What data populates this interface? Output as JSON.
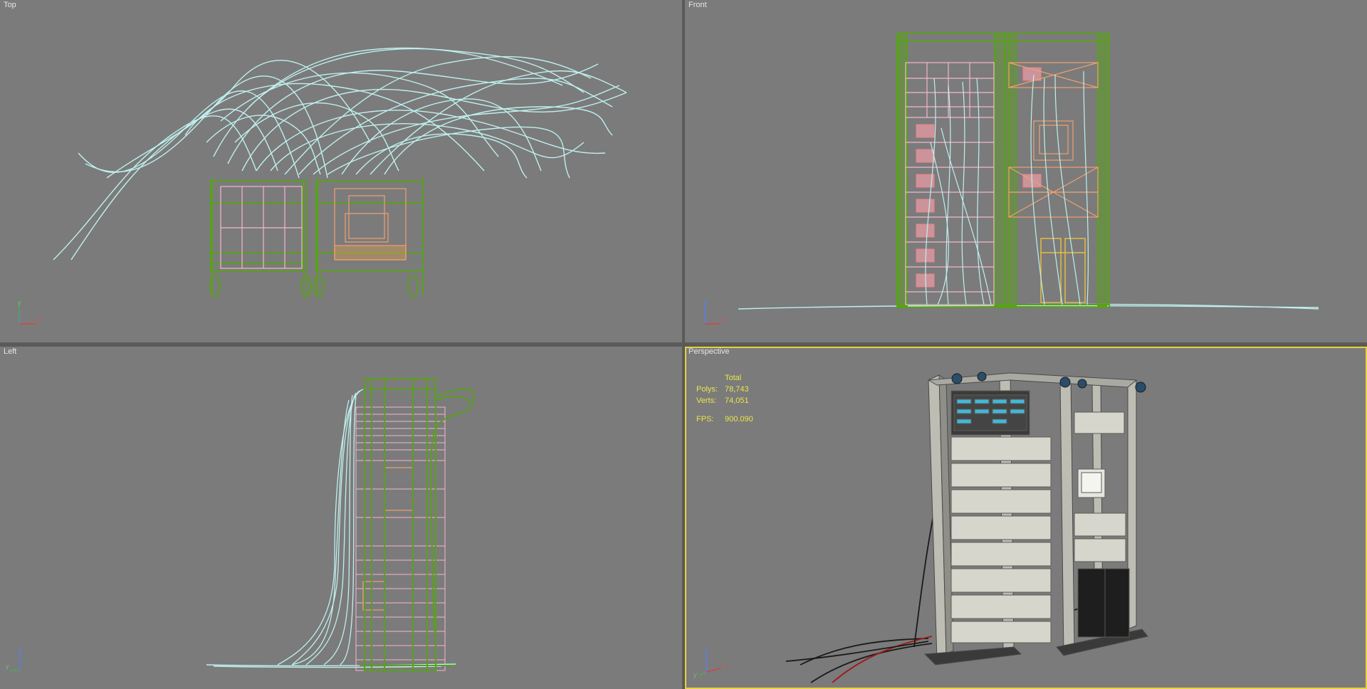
{
  "viewports": {
    "top": {
      "label": "Top",
      "axes": [
        "y",
        "x",
        "z"
      ]
    },
    "front": {
      "label": "Front",
      "axes": [
        "z",
        "x"
      ]
    },
    "left": {
      "label": "Left",
      "axes": [
        "z",
        "y"
      ]
    },
    "perspective": {
      "label": "Perspective",
      "axes": [
        "z",
        "y",
        "x"
      ],
      "active": true
    }
  },
  "stats": {
    "header": "Total",
    "polys_label": "Polys:",
    "polys_value": "78,743",
    "verts_label": "Verts:",
    "verts_value": "74,051",
    "fps_label": "FPS:",
    "fps_value": "900.090"
  },
  "colors": {
    "viewport_bg": "#7b7b7b",
    "active_border": "#e7d23a",
    "rack_wire": "#5aa01c",
    "cable_wire": "#bff0ee",
    "server_wire": "#f4b6d0",
    "device_wire": "#f0a070",
    "stats_text": "#e9e64a"
  }
}
